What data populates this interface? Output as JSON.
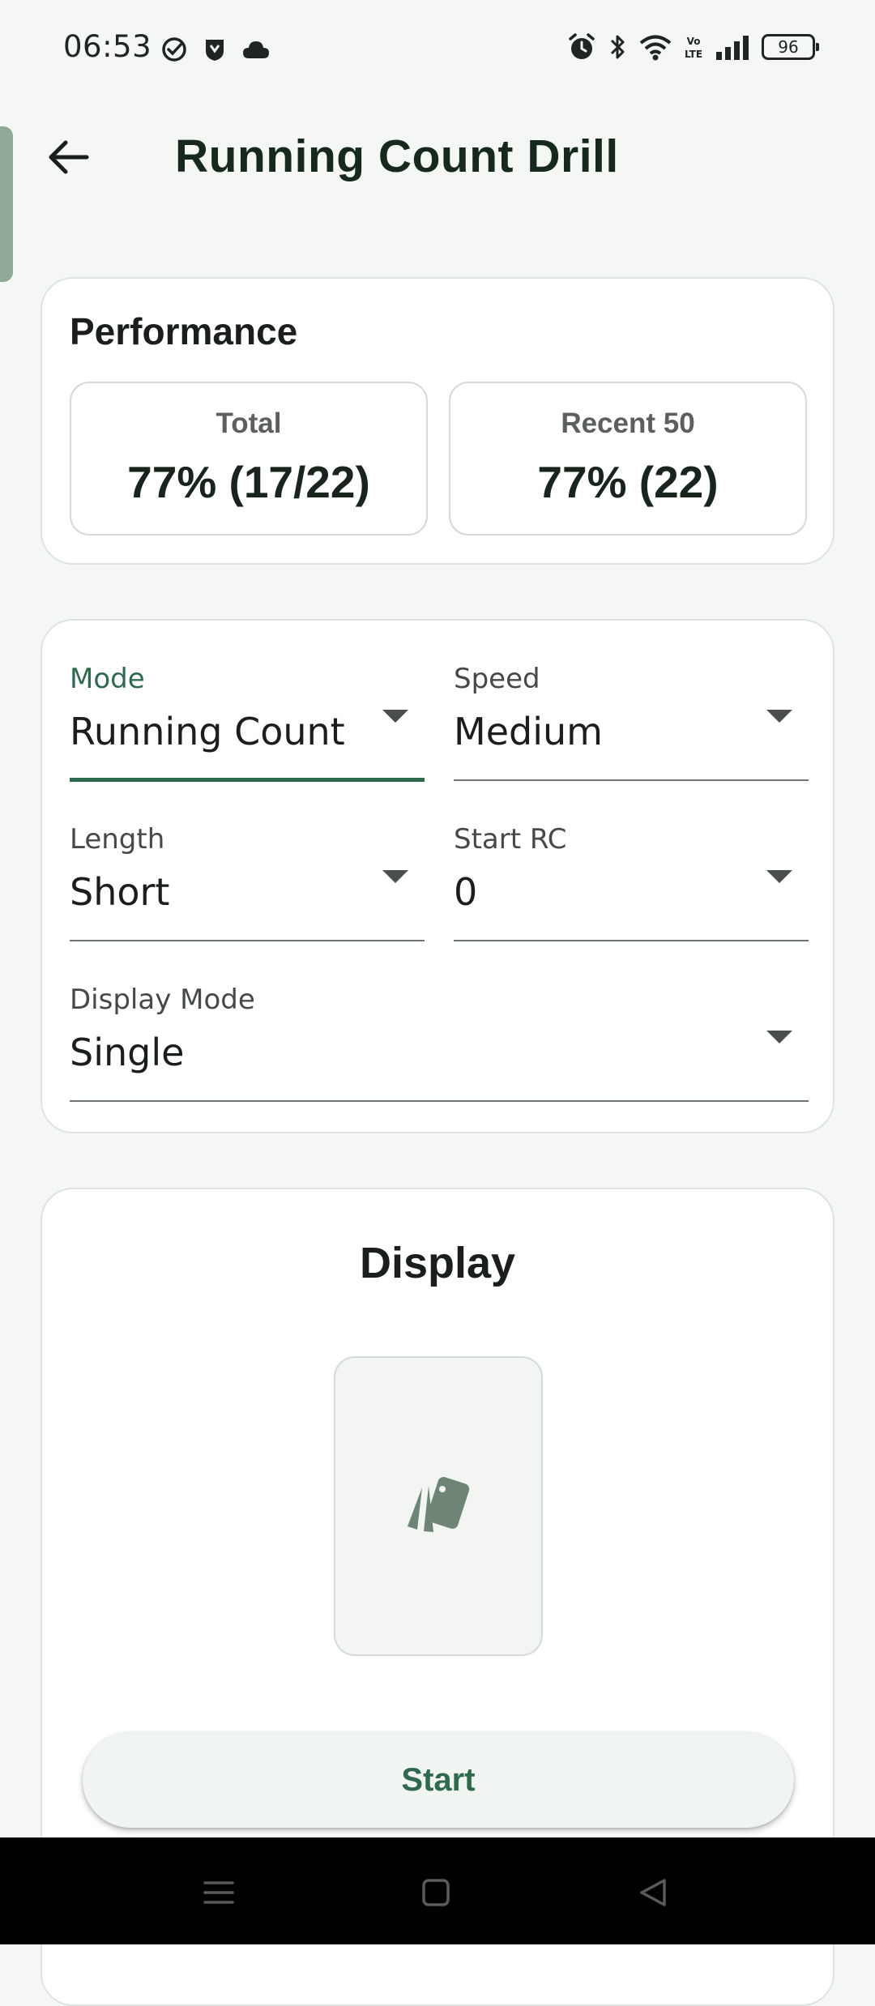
{
  "status_bar": {
    "time": "06:53",
    "left_icons": [
      "check-circle-icon",
      "shield-icon",
      "cloud-icon"
    ],
    "right_icons": [
      "alarm-icon",
      "bluetooth-icon",
      "wifi-icon",
      "volte-icon",
      "signal-icon"
    ],
    "volte_label": "Vo LTE",
    "battery_level": "96"
  },
  "app_bar": {
    "back_icon": "arrow-left-icon",
    "title": "Running Count Drill"
  },
  "performance": {
    "title": "Performance",
    "total": {
      "label": "Total",
      "value": "77% (17/22)"
    },
    "recent": {
      "label": "Recent 50",
      "value": "77% (22)"
    }
  },
  "settings": {
    "mode": {
      "label": "Mode",
      "value": "Running Count"
    },
    "speed": {
      "label": "Speed",
      "value": "Medium"
    },
    "length": {
      "label": "Length",
      "value": "Short"
    },
    "start_rc": {
      "label": "Start RC",
      "value": "0"
    },
    "display_mode": {
      "label": "Display Mode",
      "value": "Single"
    }
  },
  "display": {
    "title": "Display",
    "placeholder_icon": "playing-cards-icon",
    "start_label": "Start"
  },
  "nav_bar": {
    "icons": [
      "menu-icon",
      "home-square-icon",
      "back-triangle-icon"
    ]
  },
  "colors": {
    "accent": "#2f6a4e",
    "background": "#f4f7f4",
    "card": "#ffffff",
    "side_handle": "#8ea995"
  }
}
